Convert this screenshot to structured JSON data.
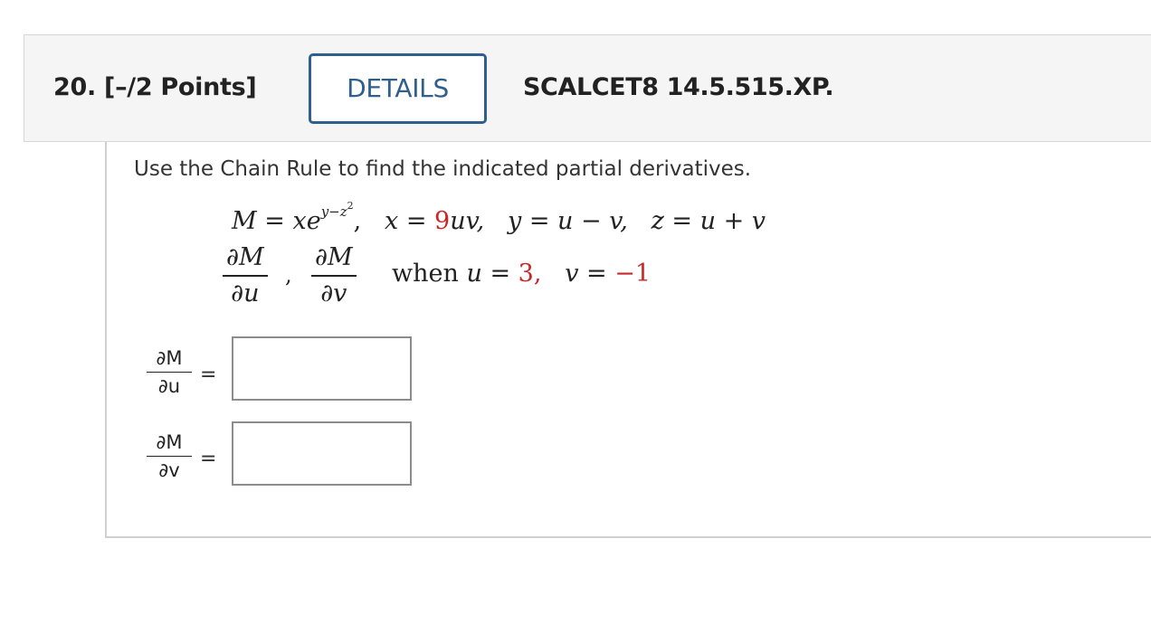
{
  "question": {
    "number": "20.",
    "points": "[–/2 Points]",
    "details_label": "DETAILS",
    "source": "SCALCET8 14.5.515.XP."
  },
  "instructions": "Use the Chain Rule to find the indicated partial derivatives.",
  "problem": {
    "M_lhs": "M",
    "equals": "=",
    "M_rhs_base": "xe",
    "M_exp": "y−z",
    "M_exp_sq": "2",
    "sep": ",",
    "x_lhs": "x",
    "x_coef": "9",
    "x_rhs": "uv,",
    "y_def": "y = u − v,",
    "z_def": "z = u + v",
    "frac1_num": "∂M",
    "frac1_den": "∂u",
    "frac2_num": "∂M",
    "frac2_den": "∂v",
    "when_word": "when",
    "u_lhs": "u",
    "u_val": "3,",
    "v_lhs": "v",
    "v_val": "−1"
  },
  "answers": [
    {
      "num": "∂M",
      "den": "∂u",
      "equals": "=",
      "value": ""
    },
    {
      "num": "∂M",
      "den": "∂v",
      "equals": "=",
      "value": ""
    }
  ],
  "colors": {
    "accent": "#2f5f8e",
    "randomized_value": "#c8282a"
  }
}
